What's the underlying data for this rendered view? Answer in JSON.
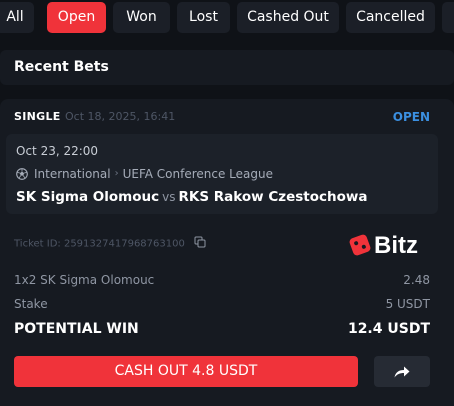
{
  "filters": {
    "tabs": [
      {
        "label": "All"
      },
      {
        "label": "Open"
      },
      {
        "label": "Won"
      },
      {
        "label": "Lost"
      },
      {
        "label": "Cashed Out"
      },
      {
        "label": "Cancelled"
      }
    ],
    "active_tab": "Open"
  },
  "section": {
    "title": "Recent Bets"
  },
  "bet": {
    "type": "SINGLE",
    "placed_at": "Oct 18, 2025, 16:41",
    "status": "OPEN",
    "event": {
      "datetime": "Oct 23, 22:00",
      "sport_icon": "soccer-ball-icon",
      "region": "International",
      "league": "UEFA Conference League",
      "home_team": "SK Sigma Olomouc",
      "vs": "vs",
      "away_team": "RKS Rakow Czestochowa"
    },
    "ticket_id": "Ticket ID: 2591327417968763100",
    "brand": "Bitz",
    "selection": {
      "label": "1x2 SK Sigma Olomouc",
      "odds": "2.48"
    },
    "stake": {
      "label": "Stake",
      "value": "5 USDT"
    },
    "potential_win": {
      "label": "POTENTIAL WIN",
      "value": "12.4 USDT"
    },
    "cashout_label": "CASH OUT 4.8 USDT"
  },
  "colors": {
    "accent": "#f0333a",
    "status_open": "#3b8fe0",
    "background": "#0f1217",
    "card": "#161a21"
  }
}
